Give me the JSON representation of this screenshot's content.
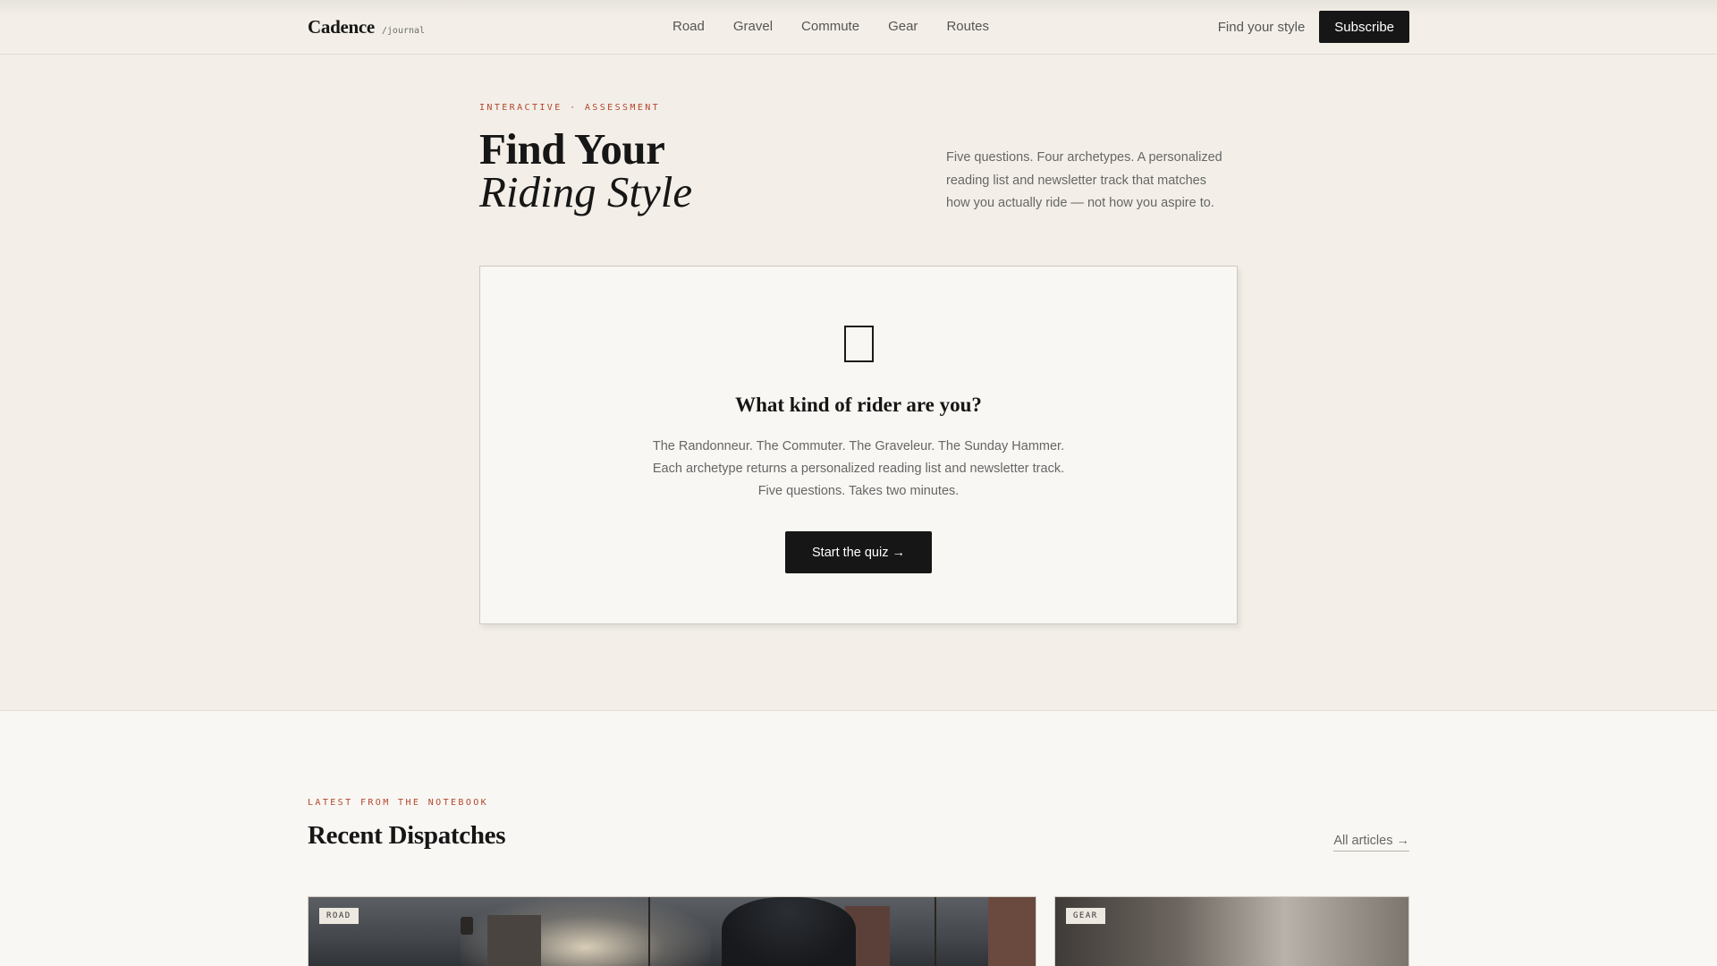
{
  "header": {
    "brand": "Cadence",
    "brand_sub": "/journal",
    "nav": [
      "Road",
      "Gravel",
      "Commute",
      "Gear",
      "Routes"
    ],
    "find_style": "Find your style",
    "subscribe": "Subscribe"
  },
  "hero": {
    "eyebrow": "INTERACTIVE · ASSESSMENT",
    "title_line1": "Find Your",
    "title_line2": "Riding Style",
    "description": "Five questions. Four archetypes. A personalized reading list and newsletter track that matches how you actually ride — not how you aspire to."
  },
  "quiz": {
    "icon": "bicycle-icon",
    "heading": "What kind of rider are you?",
    "text_line1": "The Randonneur. The Commuter. The Graveleur. The Sunday Hammer.",
    "text_line2": "Each archetype returns a personalized reading list and newsletter track.",
    "text_line3": "Five questions. Takes two minutes.",
    "button": "Start the quiz →"
  },
  "recent": {
    "eyebrow": "LATEST FROM THE NOTEBOOK",
    "title": "Recent Dispatches",
    "all_articles": "All articles →",
    "cards": [
      {
        "tag": "ROAD"
      },
      {
        "tag": "GEAR"
      }
    ]
  },
  "colors": {
    "accent": "#b3452d",
    "background": "#f3efe8",
    "ink": "#161616"
  }
}
